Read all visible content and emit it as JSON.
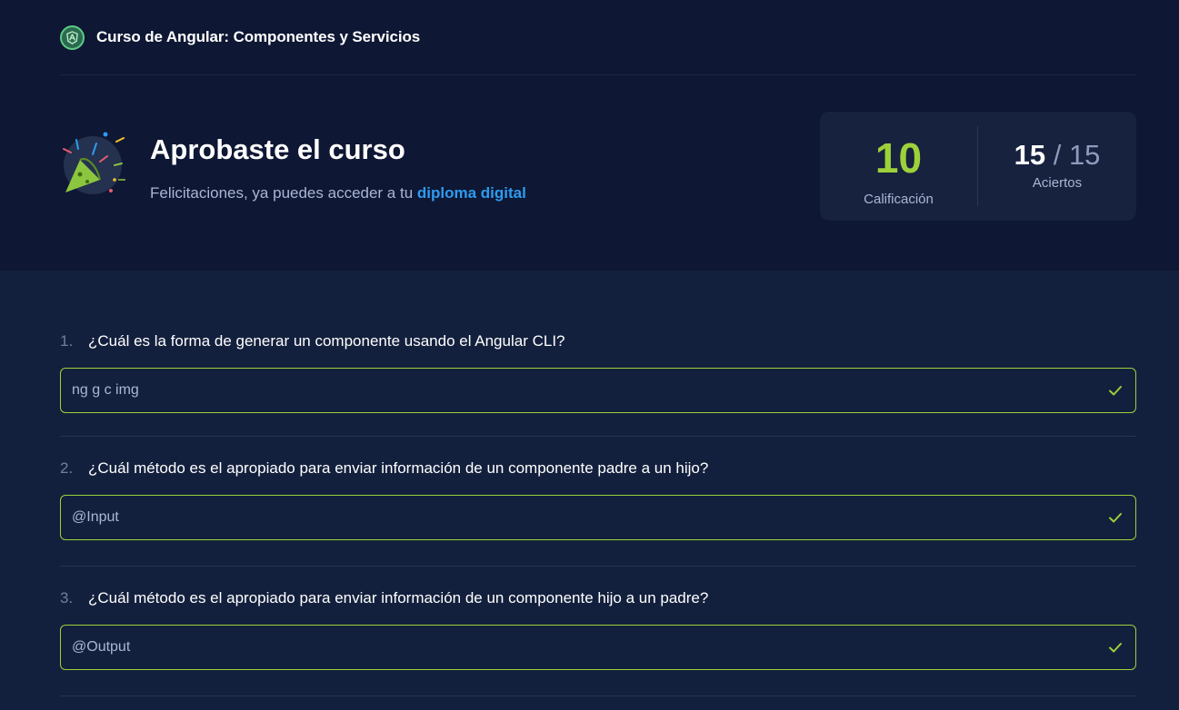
{
  "header": {
    "course_title": "Curso de Angular: Componentes y Servicios",
    "logo_icon": "angular-course-badge-icon"
  },
  "result": {
    "title": "Aprobaste el curso",
    "subtitle_prefix": "Felicitaciones, ya puedes acceder a tu ",
    "subtitle_link": "diploma digital",
    "icon": "party-popper-icon"
  },
  "score": {
    "grade": "10",
    "grade_label": "Calificación",
    "correct": "15",
    "separator": "/",
    "total": "15",
    "hits_label": "Aciertos"
  },
  "colors": {
    "page_bg": "#13203d",
    "top_bg": "#0e1733",
    "accent_green": "#9dd13a",
    "link_blue": "#2e9bf0"
  },
  "questions": [
    {
      "number": "1.",
      "text": "¿Cuál es la forma de generar un componente usando el Angular CLI?",
      "answer": "ng g c img",
      "status_icon": "check-icon"
    },
    {
      "number": "2.",
      "text": "¿Cuál método es el apropiado para enviar información de un componente padre a un hijo?",
      "answer": "@Input",
      "status_icon": "check-icon"
    },
    {
      "number": "3.",
      "text": "¿Cuál método es el apropiado para enviar información de un componente hijo a un padre?",
      "answer": "@Output",
      "status_icon": "check-icon"
    }
  ]
}
